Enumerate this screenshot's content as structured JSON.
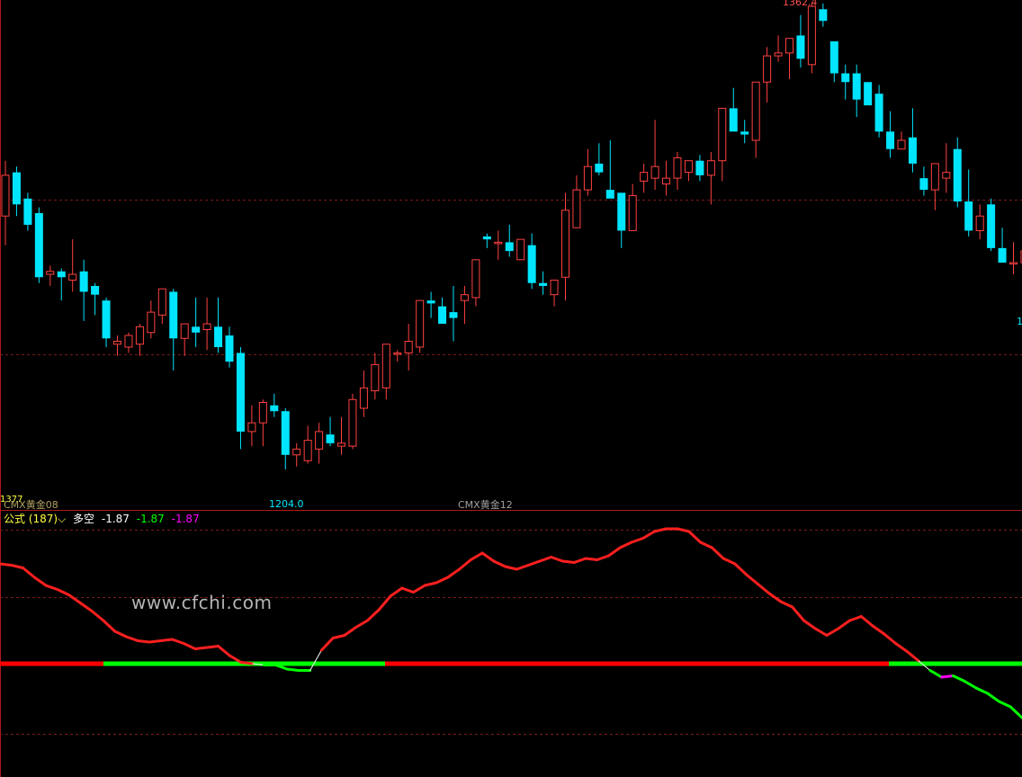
{
  "chart_data": [
    {
      "type": "candlestick",
      "annotations": {
        "high_label": "1362.4",
        "low_label": "1204.0",
        "right_cut_label": "1",
        "y_cut_label": "1377"
      },
      "contract_labels": [
        "CMX黄金08",
        "CMX黄金12"
      ],
      "candles": [
        [
          1291,
          1310,
          1281,
          1305
        ],
        [
          1306,
          1308,
          1291,
          1295
        ],
        [
          1297,
          1299,
          1286,
          1288
        ],
        [
          1292,
          1294,
          1268,
          1270
        ],
        [
          1271,
          1274,
          1267,
          1272
        ],
        [
          1272,
          1273,
          1262,
          1270
        ],
        [
          1269,
          1283,
          1265,
          1271
        ],
        [
          1272,
          1276,
          1255,
          1265
        ],
        [
          1267,
          1268,
          1257,
          1264
        ],
        [
          1262,
          1263,
          1246,
          1249
        ],
        [
          1247,
          1250,
          1243,
          1248
        ],
        [
          1246,
          1251,
          1244,
          1250
        ],
        [
          1247,
          1254,
          1243,
          1253
        ],
        [
          1251,
          1262,
          1249,
          1258
        ],
        [
          1257,
          1266,
          1254,
          1266
        ],
        [
          1265,
          1266,
          1238,
          1249
        ],
        [
          1249,
          1254,
          1243,
          1254
        ],
        [
          1253,
          1263,
          1246,
          1251
        ],
        [
          1252,
          1263,
          1245,
          1254
        ],
        [
          1253,
          1263,
          1244,
          1246
        ],
        [
          1250,
          1253,
          1239,
          1241
        ],
        [
          1244,
          1246,
          1211,
          1217
        ],
        [
          1217,
          1226,
          1212,
          1220
        ],
        [
          1220,
          1228,
          1212,
          1227
        ],
        [
          1226,
          1230,
          1222,
          1224
        ],
        [
          1224,
          1225,
          1204,
          1209
        ],
        [
          1209,
          1213,
          1205,
          1211
        ],
        [
          1207,
          1219,
          1206,
          1214
        ],
        [
          1211,
          1220,
          1206,
          1217
        ],
        [
          1216,
          1222,
          1212,
          1213
        ],
        [
          1212,
          1222,
          1209,
          1213
        ],
        [
          1212,
          1230,
          1211,
          1228
        ],
        [
          1225,
          1238,
          1222,
          1232
        ],
        [
          1231,
          1244,
          1228,
          1240
        ],
        [
          1232,
          1246,
          1228,
          1247
        ],
        [
          1244,
          1245,
          1241,
          1244
        ],
        [
          1244,
          1254,
          1238,
          1248
        ],
        [
          1246,
          1262,
          1244,
          1262
        ],
        [
          1262,
          1265,
          1256,
          1261
        ],
        [
          1260,
          1263,
          1255,
          1254
        ],
        [
          1258,
          1267,
          1248,
          1256
        ],
        [
          1262,
          1267,
          1254,
          1264
        ],
        [
          1263,
          1276,
          1260,
          1276
        ],
        [
          1284,
          1285,
          1280,
          1283
        ],
        [
          1282,
          1286,
          1276,
          1282
        ],
        [
          1282,
          1288,
          1277,
          1279
        ],
        [
          1276,
          1283,
          1278,
          1283
        ],
        [
          1281,
          1285,
          1266,
          1268
        ],
        [
          1268,
          1272,
          1264,
          1267
        ],
        [
          1264,
          1269,
          1260,
          1269
        ],
        [
          1270,
          1299,
          1262,
          1293
        ],
        [
          1287,
          1305,
          1289,
          1300
        ],
        [
          1300,
          1314,
          1298,
          1308
        ],
        [
          1309,
          1316,
          1305,
          1306
        ],
        [
          1300,
          1317,
          1298,
          1297
        ],
        [
          1299,
          1298,
          1280,
          1286
        ],
        [
          1286,
          1302,
          1287,
          1298
        ],
        [
          1303,
          1309,
          1299,
          1306
        ],
        [
          1304,
          1324,
          1300,
          1308
        ],
        [
          1302,
          1310,
          1298,
          1304
        ],
        [
          1304,
          1313,
          1300,
          1311
        ],
        [
          1306,
          1308,
          1303,
          1310
        ],
        [
          1310,
          1312,
          1303,
          1305
        ],
        [
          1305,
          1313,
          1295,
          1310
        ],
        [
          1310,
          1327,
          1303,
          1328
        ],
        [
          1328,
          1335,
          1321,
          1320
        ],
        [
          1320,
          1324,
          1316,
          1319
        ],
        [
          1317,
          1337,
          1311,
          1337
        ],
        [
          1337,
          1349,
          1330,
          1346
        ],
        [
          1346,
          1353,
          1344,
          1347
        ],
        [
          1347,
          1351,
          1338,
          1352
        ],
        [
          1353,
          1360,
          1342,
          1345
        ],
        [
          1343,
          1364,
          1340,
          1363
        ],
        [
          1362,
          1364,
          1356,
          1358
        ],
        [
          1351,
          1347,
          1337,
          1340
        ],
        [
          1340,
          1343,
          1331,
          1337
        ],
        [
          1340,
          1343,
          1325,
          1331
        ],
        [
          1337,
          1334,
          1331,
          1329
        ],
        [
          1333,
          1336,
          1318,
          1320
        ],
        [
          1320,
          1327,
          1311,
          1314
        ],
        [
          1314,
          1320,
          1315,
          1317
        ],
        [
          1318,
          1328,
          1306,
          1309
        ],
        [
          1304,
          1308,
          1298,
          1300
        ],
        [
          1300,
          1303,
          1293,
          1309
        ],
        [
          1304,
          1316,
          1299,
          1306
        ],
        [
          1314,
          1318,
          1294,
          1296
        ],
        [
          1296,
          1307,
          1284,
          1286
        ],
        [
          1286,
          1295,
          1283,
          1291
        ],
        [
          1295,
          1297,
          1279,
          1280
        ],
        [
          1280,
          1287,
          1275,
          1275
        ],
        [
          1275,
          1282,
          1271,
          1275
        ],
        [
          1275,
          1281,
          1266,
          1279
        ],
        [
          1279,
          1282,
          1270,
          1269
        ]
      ]
    },
    {
      "type": "line",
      "indicator_name": "多空",
      "formula_label": "公式 (187)",
      "values_display": [
        "-1.87",
        "-1.87",
        "-1.87"
      ],
      "zero_line": 0,
      "y_range": [
        -1.0,
        1.0
      ],
      "series": [
        0.74,
        0.73,
        0.71,
        0.64,
        0.58,
        0.55,
        0.51,
        0.45,
        0.39,
        0.32,
        0.24,
        0.2,
        0.17,
        0.16,
        0.17,
        0.18,
        0.15,
        0.11,
        0.12,
        0.13,
        0.06,
        0.01,
        0.0,
        -0.01,
        -0.01,
        -0.04,
        -0.05,
        -0.05,
        0.1,
        0.19,
        0.21,
        0.27,
        0.32,
        0.4,
        0.5,
        0.56,
        0.53,
        0.58,
        0.6,
        0.64,
        0.7,
        0.77,
        0.82,
        0.76,
        0.72,
        0.7,
        0.73,
        0.76,
        0.79,
        0.76,
        0.75,
        0.78,
        0.77,
        0.8,
        0.86,
        0.9,
        0.93,
        0.98,
        1.0,
        1.0,
        0.98,
        0.9,
        0.86,
        0.78,
        0.74,
        0.66,
        0.59,
        0.52,
        0.46,
        0.42,
        0.32,
        0.26,
        0.21,
        0.26,
        0.32,
        0.35,
        0.28,
        0.22,
        0.15,
        0.09,
        0.02,
        -0.05,
        -0.1,
        -0.09,
        -0.13,
        -0.18,
        -0.22,
        -0.28,
        -0.32,
        -0.4
      ],
      "colors": {
        "up": "#ff1f1f",
        "down": "#00ff00",
        "mid": "#ff00ff",
        "zero": "#ff0000",
        "bull_zero": "#00ff00"
      }
    }
  ],
  "legend": {
    "name": "公式 (187)",
    "indicator": "多空",
    "v1": "-1.87",
    "v2": "-1.87",
    "v3": "-1.87"
  },
  "watermark": "www.cfchi.com"
}
